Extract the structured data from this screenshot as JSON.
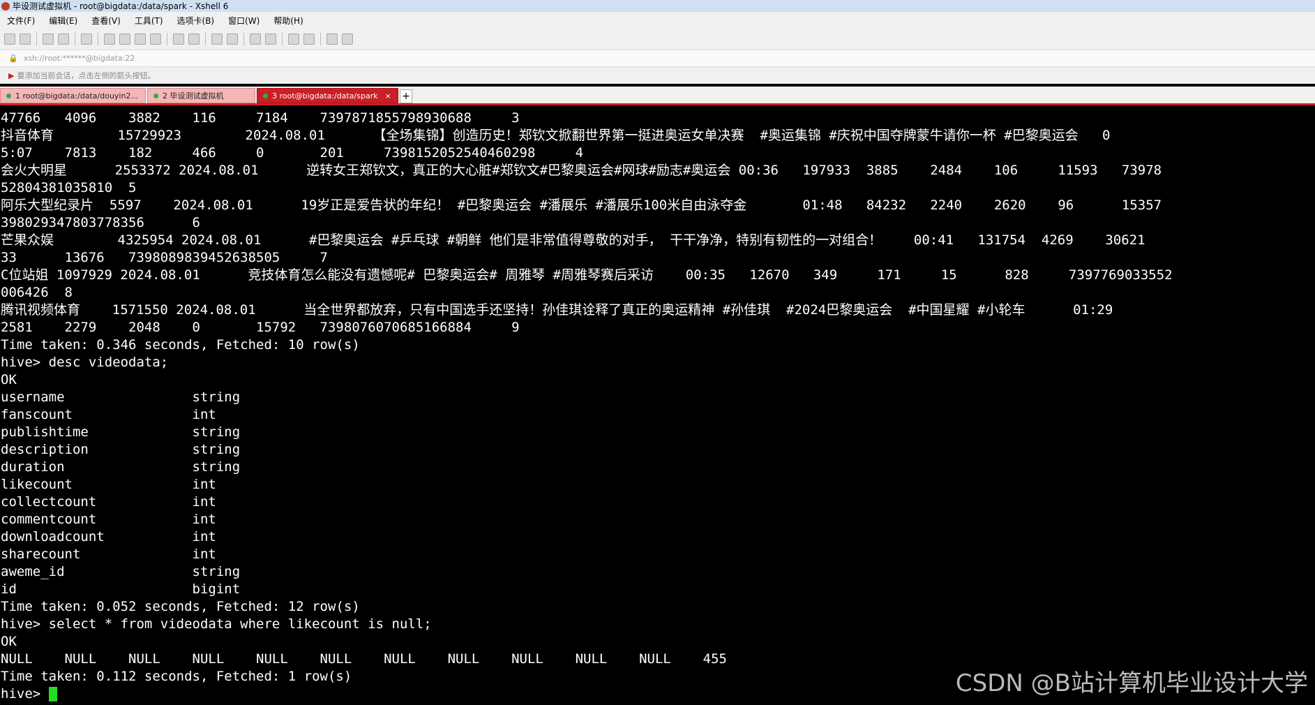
{
  "window": {
    "title": "毕设测试虚拟机 - root@bigdata:/data/spark - Xshell 6"
  },
  "menu": [
    "文件(F)",
    "编辑(E)",
    "查看(V)",
    "工具(T)",
    "选项卡(B)",
    "窗口(W)",
    "帮助(H)"
  ],
  "address": {
    "text": "xsh://root:******@bigdata:22"
  },
  "hint": {
    "text": "要添加当前会话，点击左侧的箭头按钮。"
  },
  "tabs": [
    {
      "label": "1 root@bigdata:/data/douyin2..."
    },
    {
      "label": "2 毕设测试虚拟机"
    },
    {
      "label": "3 root@bigdata:/data/spark",
      "close": "×"
    }
  ],
  "tab_new": "+",
  "terminal": {
    "lines": [
      "47766   4096    3882    116     7184    7397871855798930688     3",
      "抖音体育        15729923        2024.08.01      【全场集锦】创造历史！郑钦文掀翻世界第一挺进奥运女单决赛  #奥运集锦 #庆祝中国夺牌蒙牛请你一杯 #巴黎奥运会   0",
      "5:07    7813    182     466     0       201     7398152052540460298     4",
      "会火大明星      2553372 2024.08.01      逆转女王郑钦文，真正的大心脏#郑钦文#巴黎奥运会#网球#励志#奥运会 00:36   197933  3885    2484    106     11593   73978",
      "52804381035810  5",
      "阿乐大型纪录片  5597    2024.08.01      19岁正是爱告状的年纪！ #巴黎奥运会 #潘展乐 #潘展乐100米自由泳夺金       01:48   84232   2240    2620    96      15357",
      "398029347803778356      6",
      "芒果众娱        4325954 2024.08.01      #巴黎奥运会 #乒乓球 #朝鲜 他们是非常值得尊敬的对手， 干干净净，特别有韧性的一对组合！    00:41   131754  4269    30621",
      "33      13676   7398089839452638505     7",
      "C位站姐 1097929 2024.08.01      竞技体育怎么能没有遗憾呢# 巴黎奥运会# 周雅琴 #周雅琴赛后采访    00:35   12670   349     171     15      828     7397769033552",
      "006426  8",
      "腾讯视频体育    1571550 2024.08.01      当全世界都放弃，只有中国选手还坚持！孙佳琪诠释了真正的奥运精神 #孙佳琪  #2024巴黎奥运会  #中国星耀 #小轮车      01:29",
      "2581    2279    2048    0       15792   7398076070685166884     9",
      "Time taken: 0.346 seconds, Fetched: 10 row(s)",
      "hive> desc videodata;",
      "OK",
      "username                string",
      "fanscount               int",
      "publishtime             string",
      "description             string",
      "duration                string",
      "likecount               int",
      "collectcount            int",
      "commentcount            int",
      "downloadcount           int",
      "sharecount              int",
      "aweme_id                string",
      "id                      bigint",
      "Time taken: 0.052 seconds, Fetched: 12 row(s)",
      "hive> select * from videodata where likecount is null;",
      "OK",
      "NULL    NULL    NULL    NULL    NULL    NULL    NULL    NULL    NULL    NULL    NULL    455",
      "Time taken: 0.112 seconds, Fetched: 1 row(s)",
      "hive> "
    ]
  },
  "watermark": "CSDN @B站计算机毕业设计大学"
}
